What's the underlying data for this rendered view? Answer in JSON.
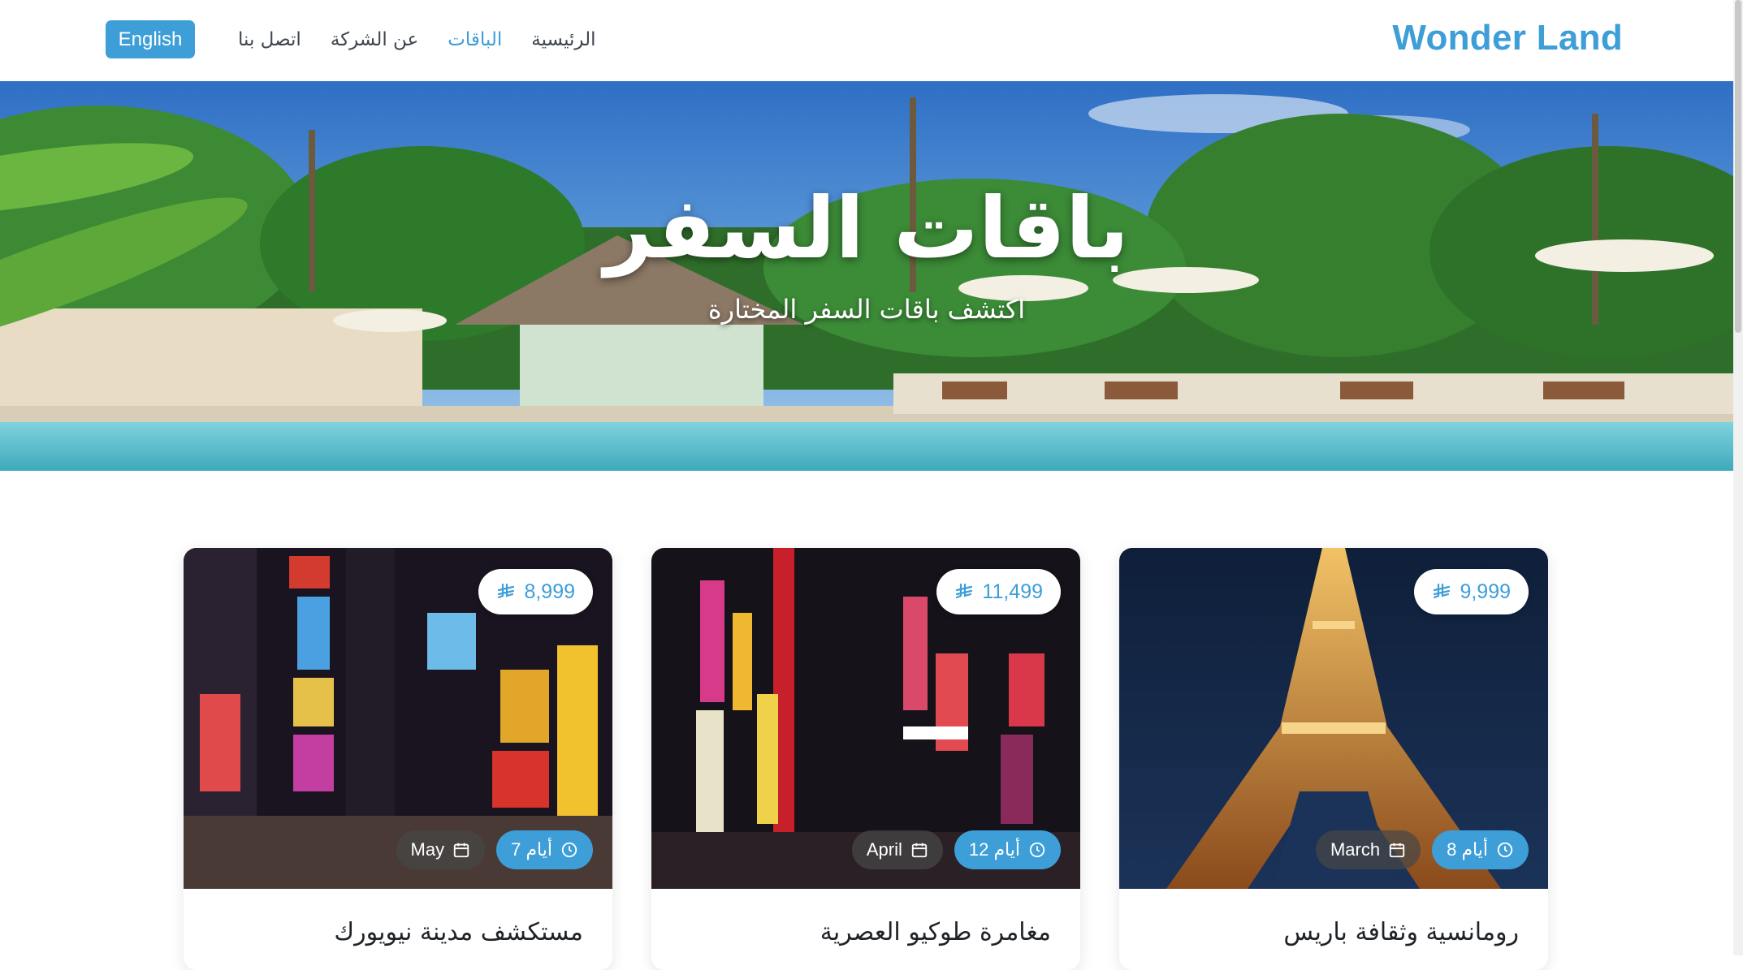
{
  "navbar": {
    "brand": "Wonder Land",
    "links": [
      {
        "label": "الرئيسية",
        "active": false
      },
      {
        "label": "الباقات",
        "active": true
      },
      {
        "label": "عن الشركة",
        "active": false
      },
      {
        "label": "اتصل بنا",
        "active": false
      }
    ],
    "language_button": "English"
  },
  "hero": {
    "title": "باقات السفر",
    "subtitle": "اكتشف باقات السفر المختارة"
  },
  "packages": [
    {
      "title": "رومانسية وثقافة باريس",
      "price": "9,999",
      "duration": "8 أيام",
      "month": "March",
      "image": "eiffel-tower-night"
    },
    {
      "title": "مغامرة طوكيو العصرية",
      "price": "11,499",
      "duration": "12 أيام",
      "month": "April",
      "image": "tokyo-neon-street"
    },
    {
      "title": "مستكشف مدينة نيويورك",
      "price": "8,999",
      "duration": "7 أيام",
      "month": "May",
      "image": "times-square-night"
    }
  ],
  "colors": {
    "accent": "#3d9ed8",
    "text": "#1f2328"
  },
  "icons": {
    "currency": "saudi-riyal-icon",
    "clock": "clock-icon",
    "calendar": "calendar-icon"
  }
}
